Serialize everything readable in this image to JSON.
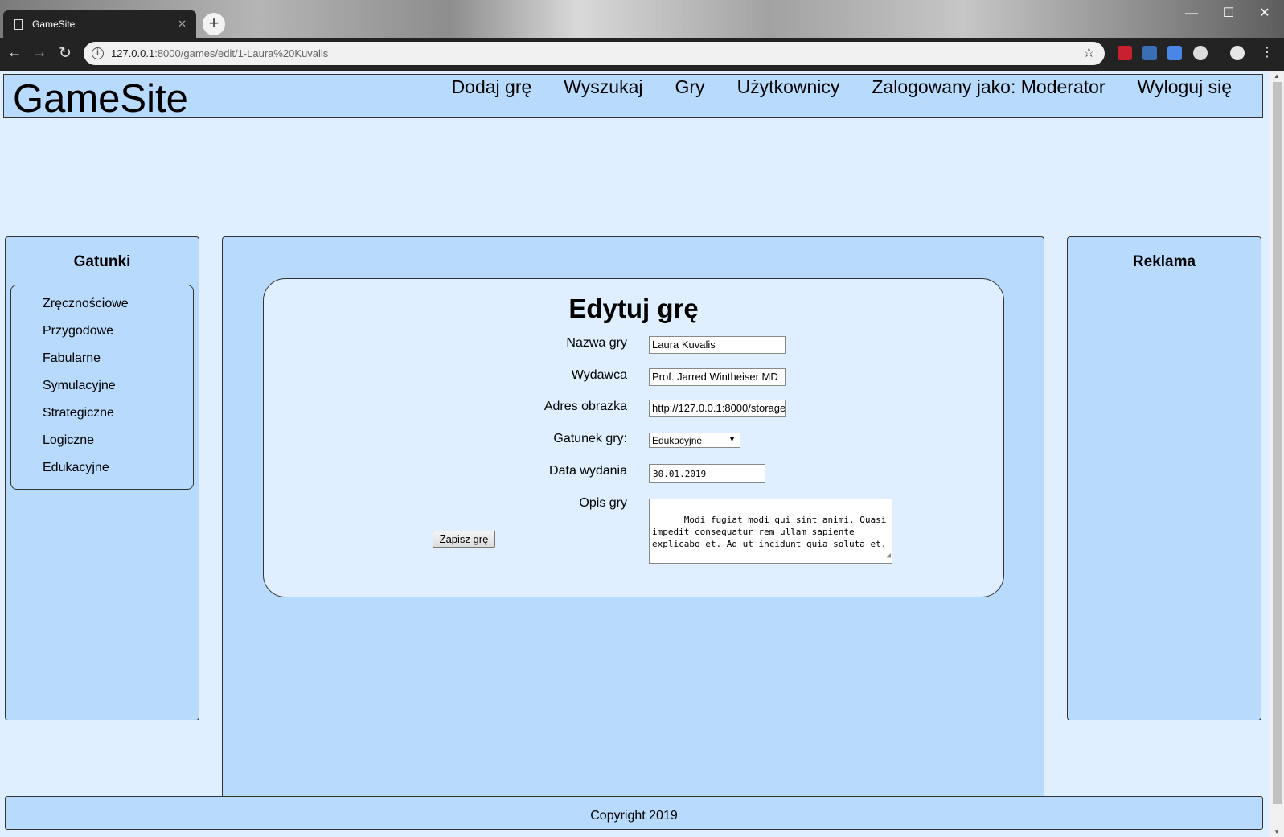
{
  "browser": {
    "tab_title": "GameSite",
    "url_host": "127.0.0.1",
    "url_path": ":8000/games/edit/1-Laura%20Kuvalis"
  },
  "site": {
    "logo": "GameSite",
    "nav": [
      "Dodaj grę",
      "Wyszukaj",
      "Gry",
      "Użytkownicy",
      "Zalogowany jako: Moderator",
      "Wyloguj się"
    ]
  },
  "sidebar": {
    "title": "Gatunki",
    "genres": [
      "Zręcznościowe",
      "Przygodowe",
      "Fabularne",
      "Symulacyjne",
      "Strategiczne",
      "Logiczne",
      "Edukacyjne"
    ]
  },
  "ads": {
    "title": "Reklama"
  },
  "form": {
    "title": "Edytuj grę",
    "name_label": "Nazwa gry",
    "name_value": "Laura Kuvalis",
    "publisher_label": "Wydawca",
    "publisher_value": "Prof. Jarred Wintheiser MD",
    "image_label": "Adres obrazka",
    "image_value": "http://127.0.0.1:8000/storage",
    "genre_label": "Gatunek gry:",
    "genre_value": "Edukacyjne",
    "date_label": "Data wydania",
    "date_value": "30.01.2019",
    "desc_label": "Opis gry",
    "desc_value": "Modi fugiat modi qui sint animi. Quasi impedit consequatur rem ullam sapiente explicabo et. Ad ut incidunt quia soluta et.",
    "save_label": "Zapisz grę"
  },
  "footer": {
    "text": "Copyright 2019"
  }
}
